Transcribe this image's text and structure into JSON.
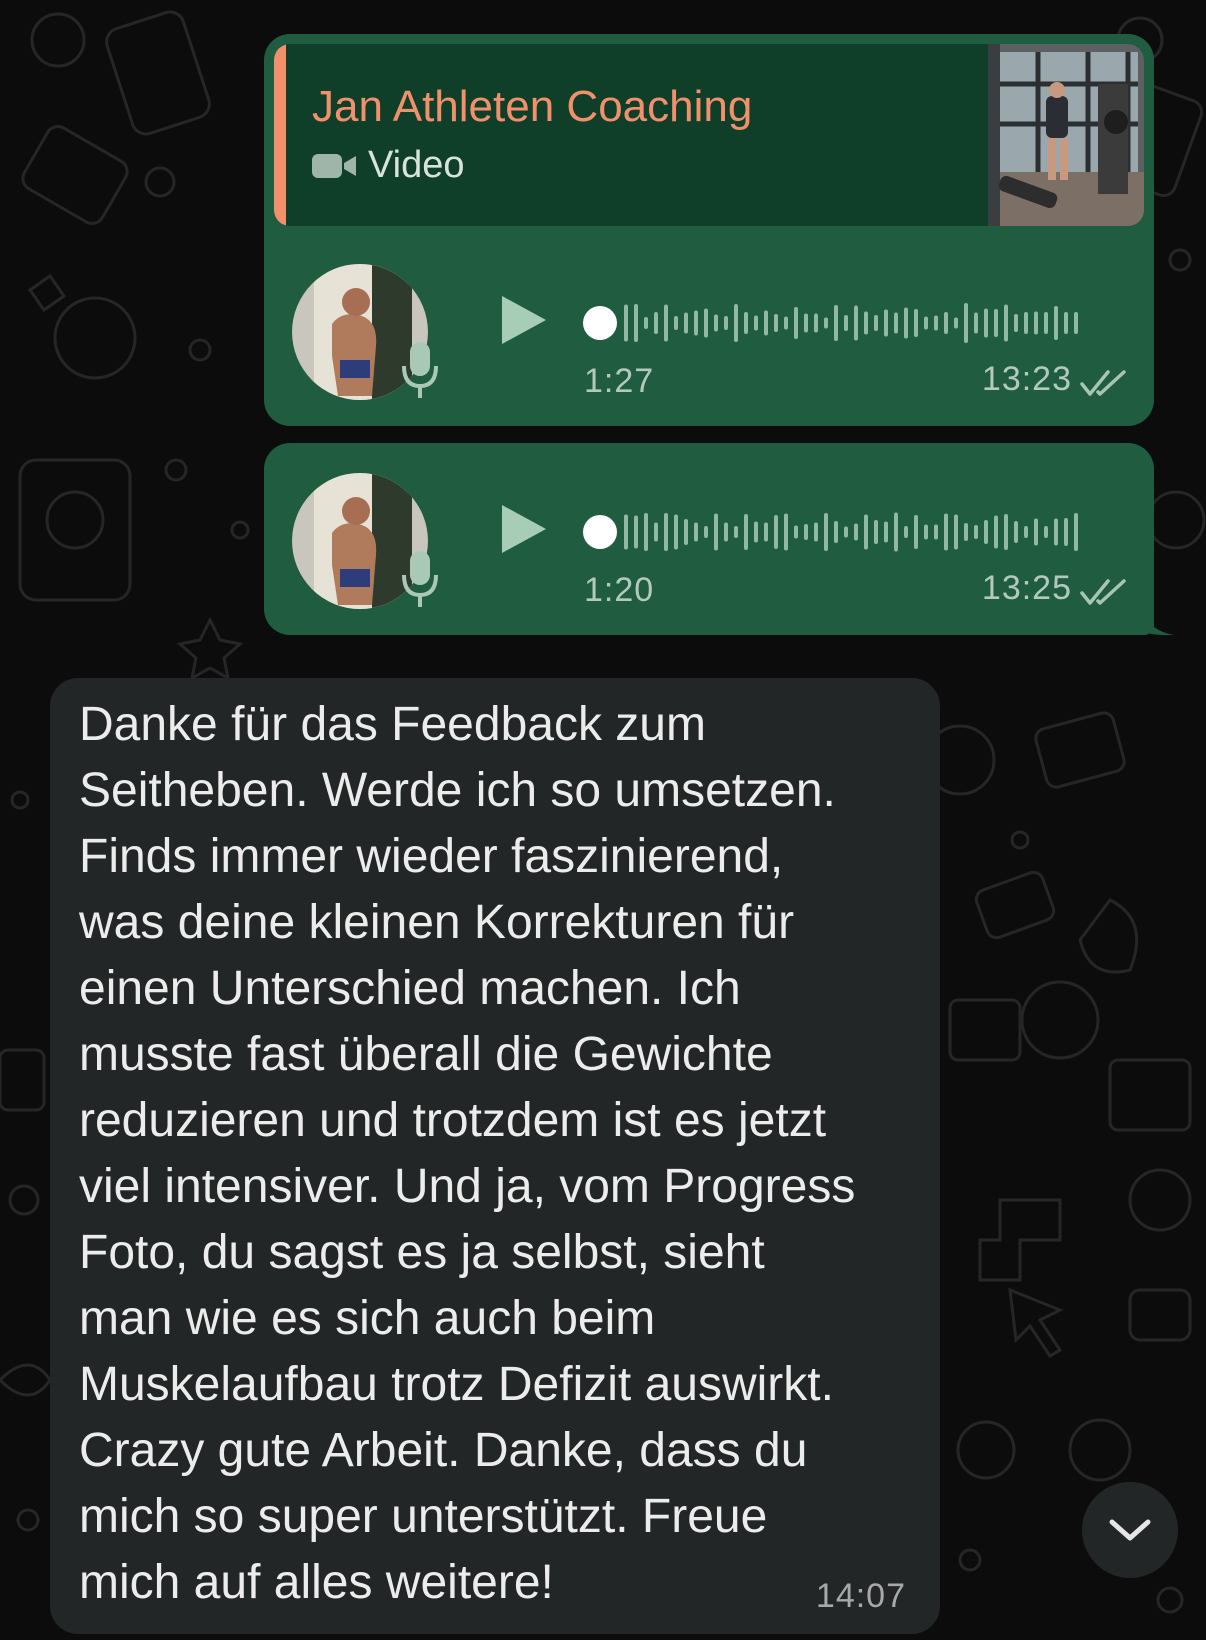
{
  "messages": [
    {
      "quote": {
        "title": "Jan Athleten Coaching",
        "media_label": "Video",
        "media_icon": "video-camera-icon"
      },
      "voice": {
        "duration": "1:27",
        "time": "13:23",
        "status": "read"
      }
    },
    {
      "voice": {
        "duration": "1:20",
        "time": "13:25",
        "status": "read"
      }
    },
    {
      "lines": [
        "Danke für das Feedback zum",
        "Seitheben. Werde ich so umsetzen.",
        "Finds immer wieder faszinierend,",
        "was deine kleinen Korrekturen für",
        "einen Unterschied machen. Ich",
        "musste fast überall die Gewichte",
        "reduzieren und trotzdem ist es jetzt",
        "viel intensiver. Und ja, vom Progress",
        "Foto, du sagst es ja selbst, sieht",
        "man wie es sich auch beim",
        "Muskelaufbau trotz Defizit auswirkt.",
        "Crazy gute Arbeit. Danke, dass du",
        "mich so super unterstützt. Freue",
        "mich auf alles weitere!"
      ],
      "time": "14:07"
    }
  ],
  "colors": {
    "background": "#0c0c0c",
    "outgoing_bubble": "#1f5c40",
    "quote_box": "#103f29",
    "quote_accent": "#f2906b",
    "incoming_bubble": "#232626"
  },
  "icons": [
    "play-icon",
    "microphone-icon",
    "double-check-icon",
    "video-camera-icon",
    "chevron-down-icon"
  ]
}
